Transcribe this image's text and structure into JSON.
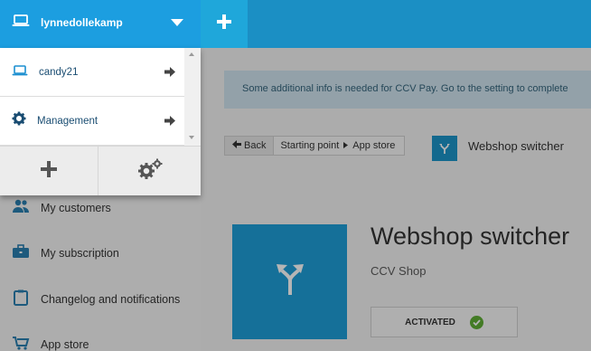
{
  "header": {
    "shop_name": "lynnedollekamp"
  },
  "shop_switcher": {
    "shops": [
      {
        "label": "candy21",
        "icon": "laptop-icon"
      },
      {
        "label": "Management",
        "icon": "gear-icon"
      }
    ],
    "add_icon": "plus-icon",
    "settings_icon": "gears-icon"
  },
  "sidebar": {
    "items": [
      {
        "label": "My customers",
        "icon": "people-icon"
      },
      {
        "label": "My subscription",
        "icon": "briefcase-icon"
      },
      {
        "label": "Changelog and notifications",
        "icon": "clipboard-icon"
      },
      {
        "label": "App store",
        "icon": "cart-icon"
      }
    ]
  },
  "notice": {
    "text": "Some additional info is needed for CCV Pay. Go to the setting to complete"
  },
  "breadcrumb": {
    "back_label": "Back",
    "path": [
      "Starting point",
      "App store"
    ],
    "current": "Webshop switcher"
  },
  "app": {
    "name": "Webshop switcher",
    "vendor": "CCV Shop",
    "status": "ACTIVATED"
  },
  "colors": {
    "brand_blue": "#1c9ee0",
    "app_tile": "#1e9ed8",
    "check_green": "#5fae35",
    "link_blue": "#1a4d72"
  }
}
